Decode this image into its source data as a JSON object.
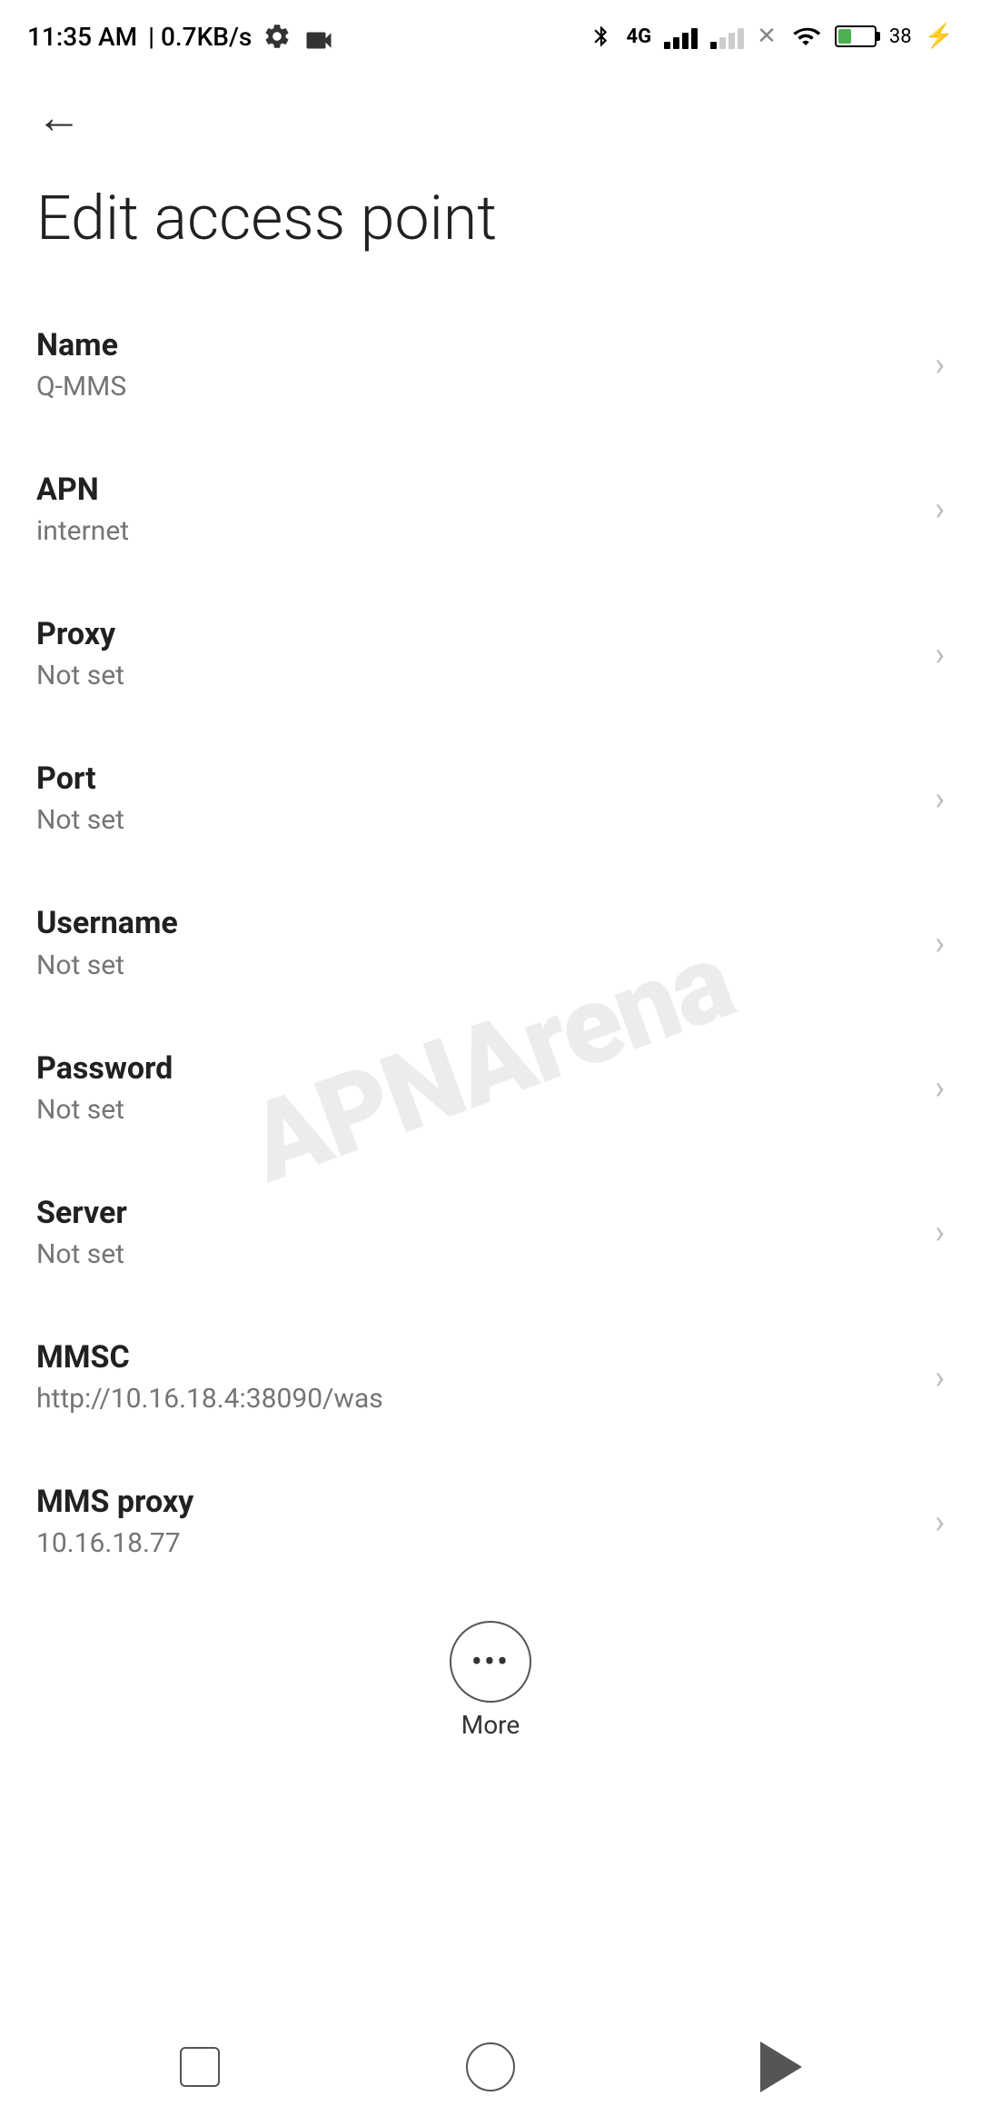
{
  "statusBar": {
    "time": "11:35 AM",
    "speed": "0.7KB/s",
    "battery": "38"
  },
  "nav": {
    "backLabel": "←"
  },
  "page": {
    "title": "Edit access point"
  },
  "settings": [
    {
      "label": "Name",
      "value": "Q-MMS"
    },
    {
      "label": "APN",
      "value": "internet"
    },
    {
      "label": "Proxy",
      "value": "Not set"
    },
    {
      "label": "Port",
      "value": "Not set"
    },
    {
      "label": "Username",
      "value": "Not set"
    },
    {
      "label": "Password",
      "value": "Not set"
    },
    {
      "label": "Server",
      "value": "Not set"
    },
    {
      "label": "MMSC",
      "value": "http://10.16.18.4:38090/was"
    },
    {
      "label": "MMS proxy",
      "value": "10.16.18.77"
    }
  ],
  "more": {
    "label": "More"
  },
  "bottomNav": {
    "square": "recent-apps",
    "circle": "home",
    "triangle": "back"
  },
  "watermark": {
    "text": "APNArena"
  }
}
